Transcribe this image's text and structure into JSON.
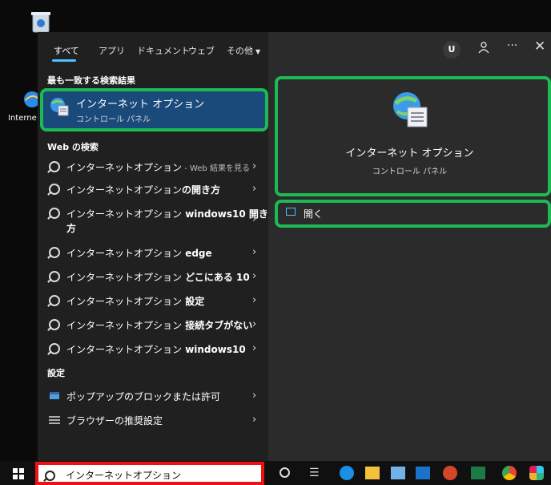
{
  "desktop": {
    "icons": [
      {
        "label": ""
      },
      {
        "label": "Interne"
      }
    ]
  },
  "tabs": [
    {
      "label": "すべて"
    },
    {
      "label": "アプリ"
    },
    {
      "label": "ドキュメント"
    },
    {
      "label": "ウェブ"
    },
    {
      "label": "その他"
    }
  ],
  "top_right": {
    "avatar": "U",
    "more": "···"
  },
  "best_match": {
    "section": "最も一致する検索結果",
    "title": "インターネット オプション",
    "subtitle": "コントロール パネル"
  },
  "web_search": {
    "section": "Web の検索",
    "results": [
      {
        "light": "インターネットオプション",
        "bold": "",
        "suffix": " - Web 結果を見る"
      },
      {
        "light": "インターネットオプション",
        "bold": "の開き方",
        "suffix": ""
      },
      {
        "light": "インターネットオプション",
        "bold": " windows10 開き",
        "suffix": "",
        "line2": "方"
      },
      {
        "light": "インターネットオプション",
        "bold": " edge",
        "suffix": ""
      },
      {
        "light": "インターネットオプション",
        "bold": " どこにある 10",
        "suffix": ""
      },
      {
        "light": "インターネットオプション",
        "bold": " 設定",
        "suffix": ""
      },
      {
        "light": "インターネットオプション",
        "bold": " 接続タブがない",
        "suffix": ""
      },
      {
        "light": "インターネットオプション",
        "bold": " windows10",
        "suffix": ""
      }
    ]
  },
  "settings": {
    "section": "設定",
    "items": [
      {
        "label": "ポップアップのブロックまたは許可"
      },
      {
        "label": "ブラウザーの推奨設定"
      }
    ]
  },
  "preview": {
    "title": "インターネット オプション",
    "subtitle": "コントロール パネル",
    "action": "開く"
  },
  "search": {
    "value": "インターネットオプション"
  },
  "colors": {
    "accent": "#194a7a",
    "highlight": "#1db954",
    "search_border": "#e11111"
  }
}
